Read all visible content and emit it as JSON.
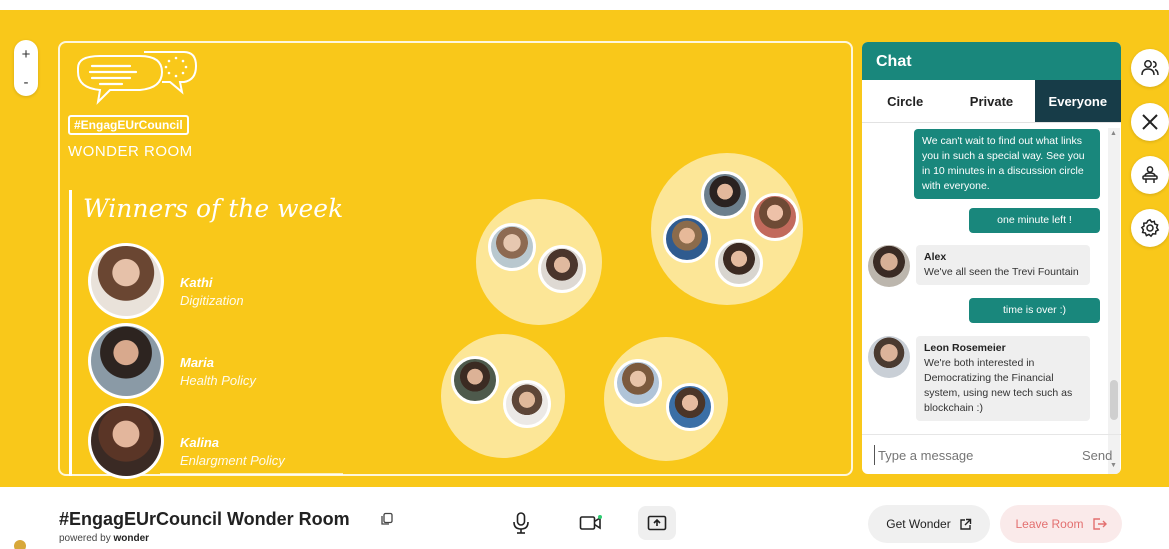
{
  "canvas": {
    "background": "#f9c81a"
  },
  "zoom": {
    "plus": "+",
    "minus": "-"
  },
  "room": {
    "hashtag": "#EngagEUrCouncil",
    "subtitle": "WONDER ROOM",
    "winners_title": "Winners of the week",
    "winners": [
      {
        "name": "Kathi",
        "topic": "Digitization"
      },
      {
        "name": "Maria",
        "topic": "Health Policy"
      },
      {
        "name": "Kalina",
        "topic": "Enlargment Policy"
      }
    ]
  },
  "chat": {
    "title": "Chat",
    "tabs": [
      "Circle",
      "Private",
      "Everyone"
    ],
    "active_tab": "Everyone",
    "messages": [
      {
        "mine": true,
        "text": "We can't wait to find out what links you in such a special way. See you in 10 minutes in a discussion circle with everyone."
      },
      {
        "mine": true,
        "text": "one minute left !"
      },
      {
        "mine": false,
        "author": "Alex",
        "text": "We've all seen the Trevi Fountain"
      },
      {
        "mine": true,
        "text": "time is over :)"
      },
      {
        "mine": false,
        "author": "Leon Rosemeier",
        "text": "We're both interested in Democratizing the Financial system, using new tech such as blockchain :)"
      }
    ],
    "input_placeholder": "Type a message",
    "send_label": "Send",
    "accent": "#19877c",
    "active_tab_bg": "#173c48"
  },
  "side_buttons": [
    "people-icon",
    "close-icon",
    "host-icon",
    "settings-icon"
  ],
  "bottom_bar": {
    "title": "#EngagEUrCouncil Wonder Room",
    "powered_prefix": "powered by",
    "powered_brand": "wonder",
    "get_wonder": "Get Wonder",
    "leave_room": "Leave Room"
  }
}
